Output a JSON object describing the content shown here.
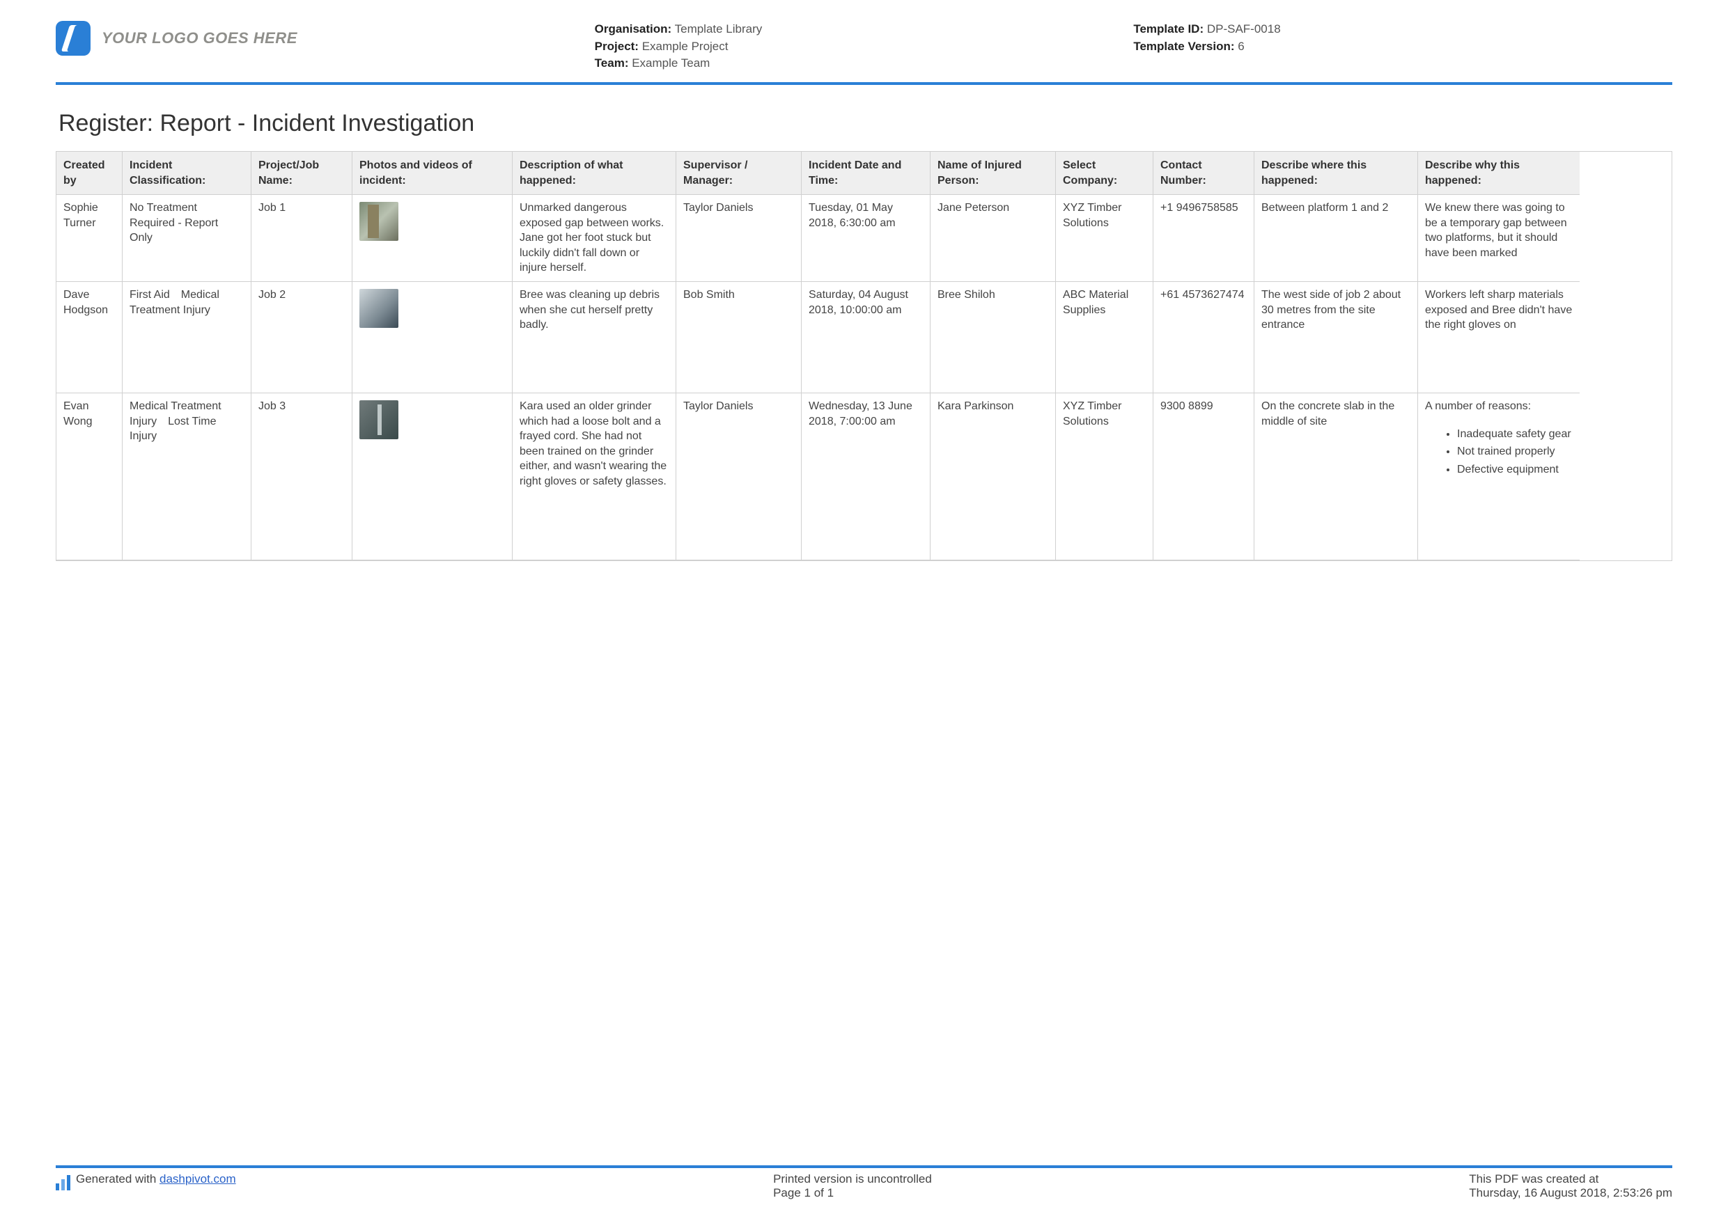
{
  "header": {
    "logoText": "YOUR LOGO GOES HERE",
    "orgLabel": "Organisation:",
    "orgValue": "Template Library",
    "projectLabel": "Project:",
    "projectValue": "Example Project",
    "teamLabel": "Team:",
    "teamValue": "Example Team",
    "templateIdLabel": "Template ID:",
    "templateIdValue": "DP-SAF-0018",
    "templateVerLabel": "Template Version:",
    "templateVerValue": "6"
  },
  "pageTitle": "Register: Report - Incident Investigation",
  "columns": {
    "createdBy": "Created by",
    "classification": "Incident Classification:",
    "job": "Project/Job Name:",
    "photos": "Photos and videos of incident:",
    "desc": "Description of what happened:",
    "supervisor": "Supervisor / Manager:",
    "datetime": "Incident Date and Time:",
    "injured": "Name of Injured Person:",
    "company": "Select Company:",
    "contact": "Contact Number:",
    "where": "Describe where this happened:",
    "why": "Describe why this happened:"
  },
  "rows": [
    {
      "createdBy": "Sophie Turner",
      "classification": "No Treatment Required - Report Only",
      "job": "Job 1",
      "desc": "Unmarked dangerous exposed gap between works. Jane got her foot stuck but luckily didn't fall down or injure herself.",
      "supervisor": "Taylor Daniels",
      "datetime": "Tuesday, 01 May 2018, 6:30:00 am",
      "injured": "Jane Peterson",
      "company": "XYZ Timber Solutions",
      "contact": "+1 9496758585",
      "where": "Between platform 1 and 2",
      "why": "We knew there was going to be a temporary gap between two platforms, but it should have been marked"
    },
    {
      "createdBy": "Dave Hodgson",
      "classification": "First Aid Medical Treatment Injury",
      "job": "Job 2",
      "desc": "Bree was cleaning up debris when she cut herself pretty badly.",
      "supervisor": "Bob Smith",
      "datetime": "Saturday, 04 August 2018, 10:00:00 am",
      "injured": "Bree Shiloh",
      "company": "ABC Material Supplies",
      "contact": "+61 4573627474",
      "where": "The west side of job 2 about 30 metres from the site entrance",
      "why": "Workers left sharp materials exposed and Bree didn't have the right gloves on"
    },
    {
      "createdBy": "Evan Wong",
      "classification": "Medical Treatment Injury Lost Time Injury",
      "job": "Job 3",
      "desc": "Kara used an older grinder which had a loose bolt and a frayed cord. She had not been trained on the grinder either, and wasn't wearing the right gloves or safety glasses.",
      "supervisor": "Taylor Daniels",
      "datetime": "Wednesday, 13 June 2018, 7:00:00 am",
      "injured": "Kara Parkinson",
      "company": "XYZ Timber Solutions",
      "contact": "9300 8899",
      "where": "On the concrete slab in the middle of site",
      "whyIntro": "A number of reasons:",
      "whyList": [
        "Inadequate safety gear",
        "Not trained properly",
        "Defective equipment"
      ]
    }
  ],
  "footer": {
    "generatedWith": "Generated with ",
    "dpLink": "dashpivot.com",
    "uncontrolled": "Printed version is uncontrolled",
    "pageOf": "Page 1 of 1",
    "createdLabel": "This PDF was created at",
    "createdValue": "Thursday, 16 August 2018, 2:53:26 pm"
  }
}
